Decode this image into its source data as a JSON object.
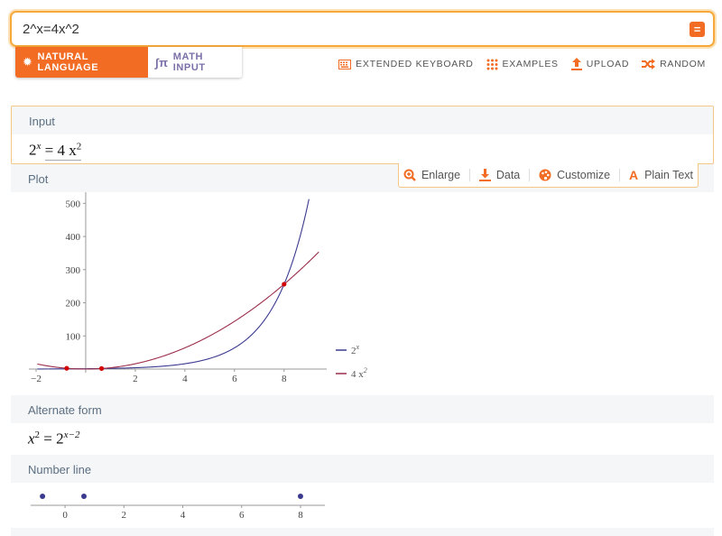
{
  "search": {
    "query": "2^x=4x^2",
    "submit_label": "="
  },
  "mode": {
    "natural": "NATURAL LANGUAGE",
    "math": "MATH INPUT"
  },
  "toolbar": {
    "keyboard": "EXTENDED KEYBOARD",
    "examples": "EXAMPLES",
    "upload": "UPLOAD",
    "random": "RANDOM"
  },
  "input_pod": {
    "title": "Input",
    "base": "2",
    "exp": "x",
    "rhs": "= 4 x",
    "rhs_exp": "2"
  },
  "plot_pod": {
    "title": "Plot",
    "tools": {
      "enlarge": "Enlarge",
      "data": "Data",
      "customize": "Customize",
      "plain": "Plain Text"
    }
  },
  "alt_pod": {
    "title": "Alternate form",
    "lhs": "x",
    "lhs_exp": "2",
    "eq": " = 2",
    "rhs_exp": "x−2"
  },
  "numberline_pod": {
    "title": "Number line"
  },
  "colors": {
    "accent": "#f26c24",
    "curve1": "#3b3a8f",
    "curve2": "#9b2d4a",
    "point": "#d40000"
  },
  "chart_data": [
    {
      "type": "line",
      "xlim": [
        -2,
        9.5
      ],
      "ylim": [
        0,
        520
      ],
      "x_ticks": [
        -2,
        2,
        4,
        6,
        8
      ],
      "x_tick_labels": [
        "−2",
        "2",
        "4",
        "6",
        "8"
      ],
      "y_ticks": [
        100,
        200,
        300,
        400,
        500
      ],
      "y_tick_labels": [
        "100",
        "200",
        "300",
        "400",
        "500"
      ],
      "series": [
        {
          "name": "2",
          "name_exp": "x",
          "func": "2^x",
          "color": "#3b3a8f"
        },
        {
          "name": "4 x",
          "name_exp": "2",
          "func": "4x^2",
          "color": "#9b2d4a"
        }
      ],
      "points": [
        {
          "x": -0.7667,
          "y": 2.35
        },
        {
          "x": 0.641,
          "y": 1.64
        },
        {
          "x": 8,
          "y": 256
        }
      ],
      "legend": "right"
    },
    {
      "type": "scatter",
      "xlim": [
        -0.8,
        8.4
      ],
      "x_ticks": [
        0,
        2,
        4,
        6,
        8
      ],
      "x_tick_labels": [
        "0",
        "2",
        "4",
        "6",
        "8"
      ],
      "points": [
        -0.7667,
        0.641,
        8
      ]
    }
  ]
}
